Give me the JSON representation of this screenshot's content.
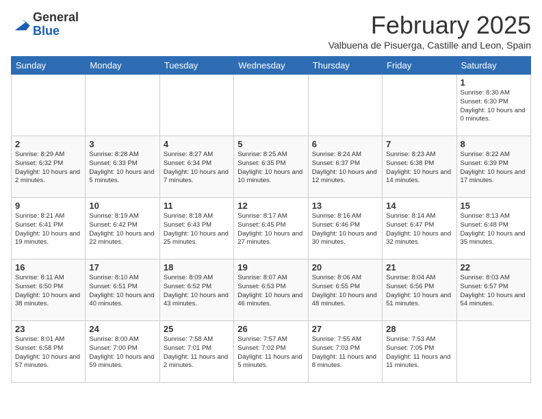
{
  "header": {
    "logo_general": "General",
    "logo_blue": "Blue",
    "month_title": "February 2025",
    "subtitle": "Valbuena de Pisuerga, Castille and Leon, Spain"
  },
  "days_of_week": [
    "Sunday",
    "Monday",
    "Tuesday",
    "Wednesday",
    "Thursday",
    "Friday",
    "Saturday"
  ],
  "weeks": [
    [
      {
        "day": "",
        "info": ""
      },
      {
        "day": "",
        "info": ""
      },
      {
        "day": "",
        "info": ""
      },
      {
        "day": "",
        "info": ""
      },
      {
        "day": "",
        "info": ""
      },
      {
        "day": "",
        "info": ""
      },
      {
        "day": "1",
        "info": "Sunrise: 8:30 AM\nSunset: 6:30 PM\nDaylight: 10 hours\nand 0 minutes."
      }
    ],
    [
      {
        "day": "2",
        "info": "Sunrise: 8:29 AM\nSunset: 6:32 PM\nDaylight: 10 hours\nand 2 minutes."
      },
      {
        "day": "3",
        "info": "Sunrise: 8:28 AM\nSunset: 6:33 PM\nDaylight: 10 hours\nand 5 minutes."
      },
      {
        "day": "4",
        "info": "Sunrise: 8:27 AM\nSunset: 6:34 PM\nDaylight: 10 hours\nand 7 minutes."
      },
      {
        "day": "5",
        "info": "Sunrise: 8:25 AM\nSunset: 6:35 PM\nDaylight: 10 hours\nand 10 minutes."
      },
      {
        "day": "6",
        "info": "Sunrise: 8:24 AM\nSunset: 6:37 PM\nDaylight: 10 hours\nand 12 minutes."
      },
      {
        "day": "7",
        "info": "Sunrise: 8:23 AM\nSunset: 6:38 PM\nDaylight: 10 hours\nand 14 minutes."
      },
      {
        "day": "8",
        "info": "Sunrise: 8:22 AM\nSunset: 6:39 PM\nDaylight: 10 hours\nand 17 minutes."
      }
    ],
    [
      {
        "day": "9",
        "info": "Sunrise: 8:21 AM\nSunset: 6:41 PM\nDaylight: 10 hours\nand 19 minutes."
      },
      {
        "day": "10",
        "info": "Sunrise: 8:19 AM\nSunset: 6:42 PM\nDaylight: 10 hours\nand 22 minutes."
      },
      {
        "day": "11",
        "info": "Sunrise: 8:18 AM\nSunset: 6:43 PM\nDaylight: 10 hours\nand 25 minutes."
      },
      {
        "day": "12",
        "info": "Sunrise: 8:17 AM\nSunset: 6:45 PM\nDaylight: 10 hours\nand 27 minutes."
      },
      {
        "day": "13",
        "info": "Sunrise: 8:16 AM\nSunset: 6:46 PM\nDaylight: 10 hours\nand 30 minutes."
      },
      {
        "day": "14",
        "info": "Sunrise: 8:14 AM\nSunset: 6:47 PM\nDaylight: 10 hours\nand 32 minutes."
      },
      {
        "day": "15",
        "info": "Sunrise: 8:13 AM\nSunset: 6:48 PM\nDaylight: 10 hours\nand 35 minutes."
      }
    ],
    [
      {
        "day": "16",
        "info": "Sunrise: 8:11 AM\nSunset: 6:50 PM\nDaylight: 10 hours\nand 38 minutes."
      },
      {
        "day": "17",
        "info": "Sunrise: 8:10 AM\nSunset: 6:51 PM\nDaylight: 10 hours\nand 40 minutes."
      },
      {
        "day": "18",
        "info": "Sunrise: 8:09 AM\nSunset: 6:52 PM\nDaylight: 10 hours\nand 43 minutes."
      },
      {
        "day": "19",
        "info": "Sunrise: 8:07 AM\nSunset: 6:53 PM\nDaylight: 10 hours\nand 46 minutes."
      },
      {
        "day": "20",
        "info": "Sunrise: 8:06 AM\nSunset: 6:55 PM\nDaylight: 10 hours\nand 48 minutes."
      },
      {
        "day": "21",
        "info": "Sunrise: 8:04 AM\nSunset: 6:56 PM\nDaylight: 10 hours\nand 51 minutes."
      },
      {
        "day": "22",
        "info": "Sunrise: 8:03 AM\nSunset: 6:57 PM\nDaylight: 10 hours\nand 54 minutes."
      }
    ],
    [
      {
        "day": "23",
        "info": "Sunrise: 8:01 AM\nSunset: 6:58 PM\nDaylight: 10 hours\nand 57 minutes."
      },
      {
        "day": "24",
        "info": "Sunrise: 8:00 AM\nSunset: 7:00 PM\nDaylight: 10 hours\nand 59 minutes."
      },
      {
        "day": "25",
        "info": "Sunrise: 7:58 AM\nSunset: 7:01 PM\nDaylight: 11 hours\nand 2 minutes."
      },
      {
        "day": "26",
        "info": "Sunrise: 7:57 AM\nSunset: 7:02 PM\nDaylight: 11 hours\nand 5 minutes."
      },
      {
        "day": "27",
        "info": "Sunrise: 7:55 AM\nSunset: 7:03 PM\nDaylight: 11 hours\nand 8 minutes."
      },
      {
        "day": "28",
        "info": "Sunrise: 7:53 AM\nSunset: 7:05 PM\nDaylight: 11 hours\nand 11 minutes."
      },
      {
        "day": "",
        "info": ""
      }
    ]
  ]
}
